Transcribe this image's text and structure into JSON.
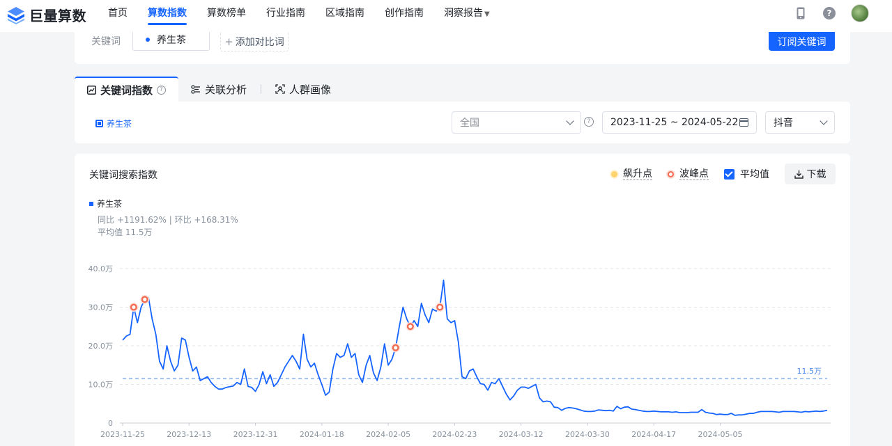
{
  "brand": {
    "name": "巨量算数"
  },
  "nav": {
    "items": [
      "首页",
      "算数指数",
      "算数榜单",
      "行业指南",
      "区域指南",
      "创作指南",
      "洞察报告"
    ],
    "active_index": 1
  },
  "keyword": {
    "label": "关键词",
    "value": "养生茶",
    "add_compare": "添加对比词",
    "subscribe": "订阅关键词"
  },
  "tabs": [
    "关键词指数",
    "关联分析",
    "人群画像"
  ],
  "filter": {
    "legend_label": "养生茶",
    "region": "全国",
    "date_range": "2023-11-25 ~ 2024-05-22",
    "platform": "抖音"
  },
  "chart_card": {
    "title": "关键词搜索指数",
    "tools": {
      "rise": "飙升点",
      "peak": "波峰点",
      "avg": "平均值",
      "download": "下载"
    },
    "series_name": "养生茶",
    "yoy_mom": "同比 +1191.62% | 环比 +168.31%",
    "avg_text": "平均值 11.5万"
  },
  "chart_data": {
    "type": "line",
    "ylim": [
      0,
      40
    ],
    "yticks": [
      "0",
      "10.0万",
      "20.0万",
      "30.0万",
      "40.0万"
    ],
    "xticks": [
      "2023-11-25",
      "2023-12-13",
      "2023-12-31",
      "2024-01-18",
      "2024-02-05",
      "2024-02-23",
      "2024-03-12",
      "2024-03-30",
      "2024-04-17",
      "2024-05-05"
    ],
    "avg_label": "11.5万",
    "avg_value": 11.5,
    "colors": {
      "line": "#1664ff",
      "peak": "#f26a4f",
      "avg": "#4a86e8"
    },
    "peaks": [
      3,
      6,
      74,
      78,
      86
    ],
    "series": [
      {
        "name": "养生茶",
        "values": [
          21.5,
          22.5,
          23,
          30,
          26,
          30,
          32,
          32.5,
          27,
          23,
          16,
          14,
          20,
          16,
          13.5,
          15,
          22,
          21.5,
          17,
          13.5,
          14.5,
          11,
          11.5,
          12,
          10.5,
          9.5,
          8.8,
          8.8,
          9.2,
          9.4,
          9.6,
          10.5,
          10,
          14,
          9.5,
          9.2,
          8.2,
          10,
          13.3,
          10.2,
          12.5,
          9.5,
          10.5,
          12.5,
          14.5,
          16,
          17.5,
          16,
          14,
          23,
          16.5,
          14.5,
          15.5,
          12.5,
          10,
          7.2,
          8,
          14,
          18,
          17,
          17.5,
          20.5,
          17,
          18,
          12.5,
          10.5,
          15,
          17.5,
          13,
          11,
          14.5,
          20.5,
          15,
          16.5,
          19.5,
          25,
          30,
          27,
          25,
          26.5,
          25,
          31,
          28,
          26,
          29.5,
          29,
          30,
          37,
          27,
          26,
          26.5,
          21,
          12,
          11.5,
          13.5,
          14,
          12,
          10.2,
          10,
          8.5,
          10.5,
          10.2,
          11.5,
          9.5,
          7.5,
          6,
          7,
          8.5,
          9.3,
          9.3,
          9,
          9.5,
          10,
          6.5,
          5.5,
          5.7,
          5.5,
          4.1,
          4,
          3.3,
          3.8,
          4,
          3.9,
          3.7,
          3.4,
          3.1,
          3,
          3,
          3.1,
          3.4,
          3.3,
          3.2,
          3.3,
          3.1,
          4.3,
          3.7,
          4.1,
          4.2,
          3.6,
          3.5,
          3.3,
          3.1,
          3,
          3,
          3.1,
          3,
          2.9,
          2.9,
          2.9,
          2.8,
          2.9,
          2.7,
          2.7,
          2.7,
          2.8,
          2.8,
          2.8,
          3.5,
          2.8,
          2.6,
          2.5,
          2.2,
          2.3,
          2.2,
          2.2,
          2.5,
          2,
          2.1,
          2.1,
          2.3,
          2.5,
          2.5,
          2.8,
          3,
          3,
          3,
          3,
          2.9,
          2.8,
          3,
          3,
          3,
          3,
          2.9,
          2.8,
          3,
          2.9,
          3,
          3.1,
          3,
          3.1,
          3.3
        ]
      }
    ]
  }
}
